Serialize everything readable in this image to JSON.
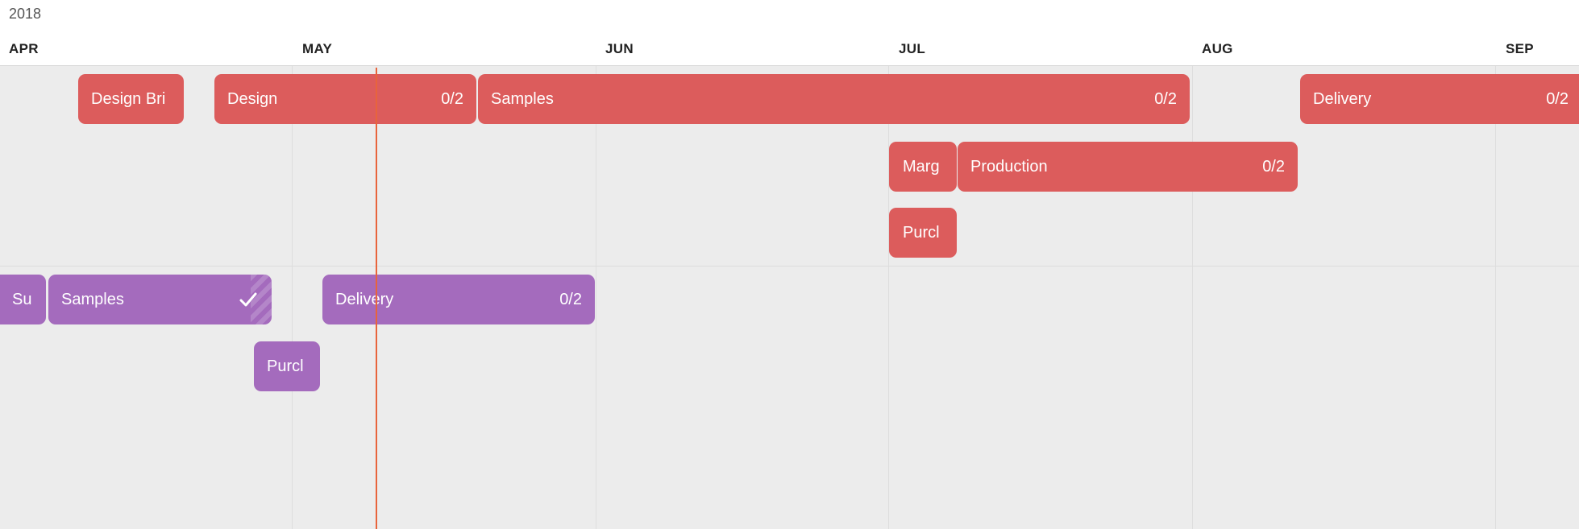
{
  "header": {
    "year": "2018",
    "months": [
      "APR",
      "MAY",
      "JUN",
      "JUL",
      "AUG",
      "SEP"
    ]
  },
  "tasks": {
    "design_brief": "Design Bri",
    "design": {
      "label": "Design",
      "count": "0/2"
    },
    "samples_red": {
      "label": "Samples",
      "count": "0/2"
    },
    "delivery_red": {
      "label": "Delivery",
      "count": "0/2"
    },
    "marg": "Marg",
    "production": {
      "label": "Production",
      "count": "0/2"
    },
    "purch_red": "Purcl",
    "su": "Su",
    "samples_purple": {
      "label": "Samples"
    },
    "delivery_purple": {
      "label": "Delivery",
      "count": "0/2"
    },
    "purch_purple": "Purcl"
  },
  "colors": {
    "red": "#dc5c5c",
    "purple": "#a46bbd",
    "today_line": "#e8643c"
  }
}
